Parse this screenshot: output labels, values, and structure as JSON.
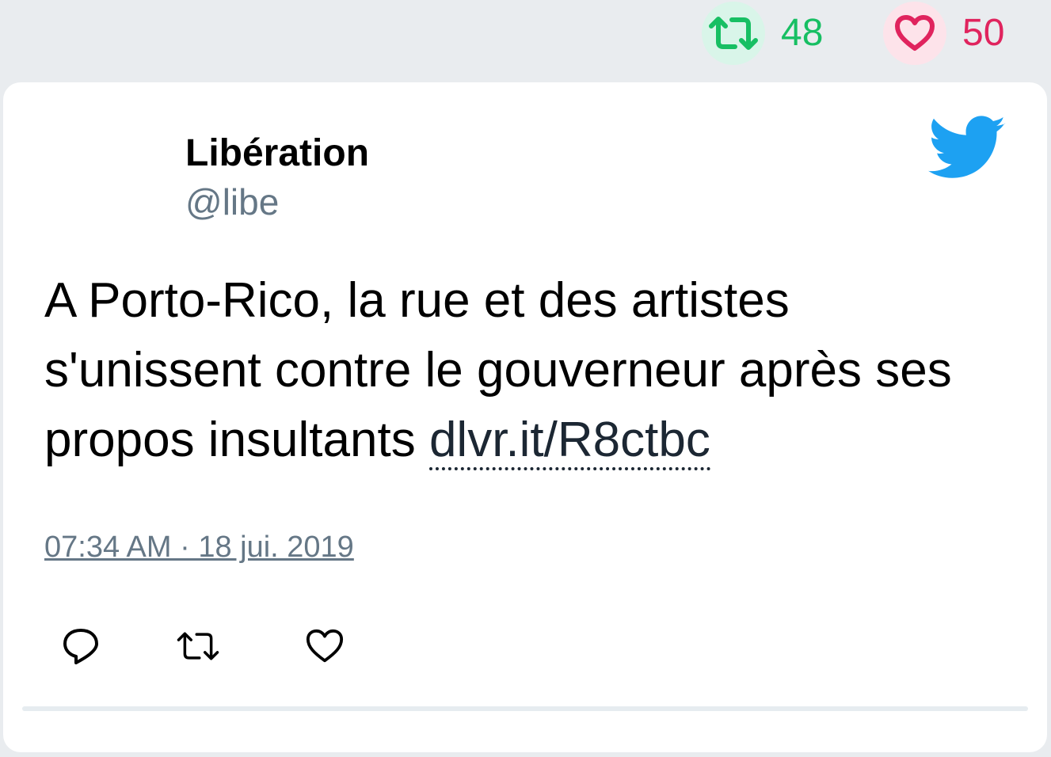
{
  "header": {
    "retweet_count": "48",
    "like_count": "50",
    "retweet_color": "#17bf63",
    "like_color": "#e0245e"
  },
  "tweet": {
    "author_name": "Libération",
    "author_handle": "@libe",
    "text": "A Porto-Rico, la rue et des artistes s'unissent contre le gouverneur après ses propos insultants ",
    "link_text": "dlvr.it/R8ctbc",
    "timestamp": "07:34 AM · 18 jui. 2019",
    "brand_icon": "twitter-bird-icon",
    "brand_color": "#1da1f2"
  },
  "actions": {
    "icons": [
      "reply-icon",
      "retweet-icon",
      "like-icon"
    ]
  }
}
